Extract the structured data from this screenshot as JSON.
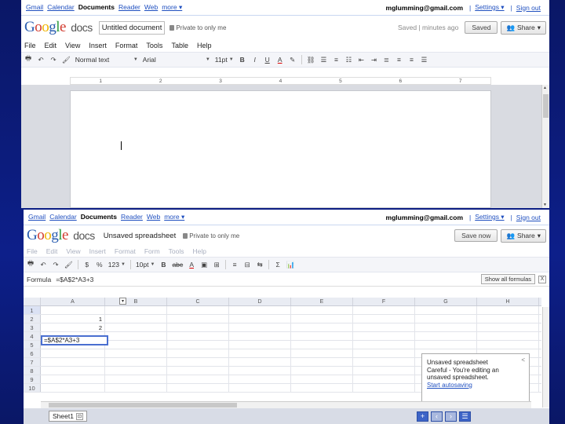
{
  "docs": {
    "gbar_left": [
      {
        "label": "Gmail",
        "current": false
      },
      {
        "label": "Calendar",
        "current": false
      },
      {
        "label": "Documents",
        "current": true
      },
      {
        "label": "Reader",
        "current": false
      },
      {
        "label": "Web",
        "current": false
      },
      {
        "label": "more ▾",
        "current": false
      }
    ],
    "email": "mglumming@gmail.com",
    "settings": "Settings ▾",
    "signout": "Sign out",
    "logo_docs": "docs",
    "doc_title": "Untitled document",
    "privacy": "Private to only me",
    "saved_text": "Saved | minutes ago",
    "save_button": "Saved",
    "share_button": "Share",
    "menu": [
      "File",
      "Edit",
      "View",
      "Insert",
      "Format",
      "Tools",
      "Table",
      "Help"
    ],
    "toolbar": {
      "style": "Normal text",
      "font": "Arial",
      "size": "11pt",
      "bold": "B",
      "italic": "I",
      "underline": "U",
      "color": "A"
    },
    "ruler": [
      "1",
      "2",
      "3",
      "4",
      "5",
      "6",
      "7"
    ]
  },
  "sheet": {
    "gbar_left": [
      {
        "label": "Gmail",
        "current": false
      },
      {
        "label": "Calendar",
        "current": false
      },
      {
        "label": "Documents",
        "current": true
      },
      {
        "label": "Reader",
        "current": false
      },
      {
        "label": "Web",
        "current": false
      },
      {
        "label": "more ▾",
        "current": false
      }
    ],
    "email": "mglumming@gmail.com",
    "settings": "Settings ▾",
    "signout": "Sign out",
    "logo_docs": "docs",
    "doc_title": "Unsaved spreadsheet",
    "privacy": "Private to only me",
    "save_button": "Save now",
    "share_button": "Share",
    "menu": [
      "File",
      "Edit",
      "View",
      "Insert",
      "Format",
      "Form",
      "Tools",
      "Help"
    ],
    "toolbar": {
      "zoom": "123",
      "font_size": "10pt",
      "bold": "B",
      "strike": "abc",
      "color": "A",
      "sum": "Σ"
    },
    "formula_label": "Formula",
    "formula_value": "=$A$2*A3+3",
    "show_formula_bar": "Show all formulas",
    "close": "X",
    "columns": [
      "A",
      "B",
      "C",
      "D",
      "E",
      "F",
      "G",
      "H"
    ],
    "rows": [
      {
        "n": "1",
        "a": ""
      },
      {
        "n": "2",
        "a": "1"
      },
      {
        "n": "3",
        "a": "2"
      },
      {
        "n": "4",
        "a": ""
      },
      {
        "n": "5",
        "a": ""
      },
      {
        "n": "6",
        "a": ""
      },
      {
        "n": "7",
        "a": ""
      },
      {
        "n": "8",
        "a": ""
      },
      {
        "n": "9",
        "a": ""
      },
      {
        "n": "10",
        "a": ""
      }
    ],
    "editing_cell_text": "=$A$2*A3+3",
    "popup": {
      "line1": "Unsaved spreadsheet",
      "line2": "Careful - You're editing an",
      "line3": "unsaved spreadsheet.",
      "link": "Start autosaving",
      "close": "<"
    },
    "sheet_tab": "Sheet1",
    "sheet_tab_menu": "⊡"
  }
}
